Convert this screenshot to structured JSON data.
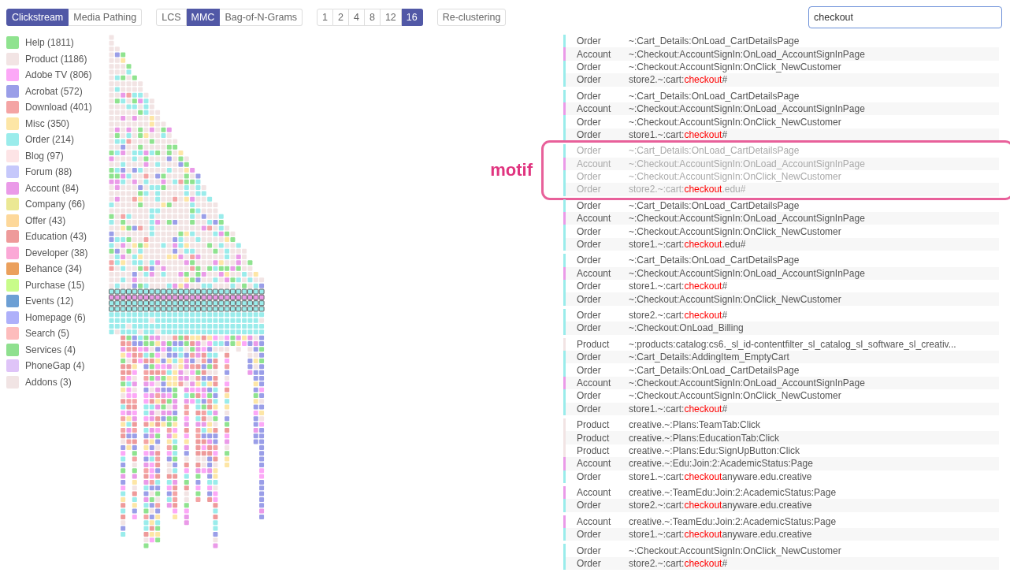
{
  "toolbar": [
    {
      "buttons": [
        {
          "label": "Clickstream",
          "selected": true
        },
        {
          "label": "Media Pathing",
          "selected": false
        }
      ]
    },
    {
      "buttons": [
        {
          "label": "LCS",
          "selected": false
        },
        {
          "label": "MMC",
          "selected": true
        },
        {
          "label": "Bag-of-N-Grams",
          "selected": false
        }
      ]
    },
    {
      "buttons": [
        {
          "label": "1",
          "selected": false
        },
        {
          "label": "2",
          "selected": false
        },
        {
          "label": "4",
          "selected": false
        },
        {
          "label": "8",
          "selected": false
        },
        {
          "label": "12",
          "selected": false
        },
        {
          "label": "16",
          "selected": true
        }
      ]
    },
    {
      "buttons": [
        {
          "label": "Re-clustering",
          "selected": false
        }
      ]
    }
  ],
  "search": {
    "value": "checkout"
  },
  "legend": [
    {
      "label": "Help (1811)",
      "color": "#8fe38f"
    },
    {
      "label": "Product (1186)",
      "color": "#f2e4e4"
    },
    {
      "label": "Adobe TV (806)",
      "color": "#fca8f7"
    },
    {
      "label": "Acrobat (572)",
      "color": "#9a9ee8"
    },
    {
      "label": "Download (401)",
      "color": "#f4a4a4"
    },
    {
      "label": "Misc (350)",
      "color": "#fde6a6"
    },
    {
      "label": "Order (214)",
      "color": "#9aeceb"
    },
    {
      "label": "Blog (97)",
      "color": "#fde4e6"
    },
    {
      "label": "Forum (88)",
      "color": "#c6c8fb"
    },
    {
      "label": "Account (84)",
      "color": "#ea9ae8"
    },
    {
      "label": "Company (66)",
      "color": "#ebe894"
    },
    {
      "label": "Offer (43)",
      "color": "#fdd89a"
    },
    {
      "label": "Education (43)",
      "color": "#ee9a9a"
    },
    {
      "label": "Developer (38)",
      "color": "#fba8d6"
    },
    {
      "label": "Behance (34)",
      "color": "#eba05c"
    },
    {
      "label": "Purchase (15)",
      "color": "#c8fc8a"
    },
    {
      "label": "Events (12)",
      "color": "#6c9fd4"
    },
    {
      "label": "Homepage (6)",
      "color": "#aeb0fa"
    },
    {
      "label": "Search (5)",
      "color": "#fdbcbc"
    },
    {
      "label": "Services (4)",
      "color": "#8fe08f"
    },
    {
      "label": "PhoneGap (4)",
      "color": "#dfc4f8"
    },
    {
      "label": "Addons (3)",
      "color": "#f1e4e4"
    }
  ],
  "groups": [
    {
      "highlighted": false,
      "events": [
        {
          "category": "Order",
          "color": "#9aeceb",
          "text": "~:Cart_Details:OnLoad_CartDetailsPage"
        },
        {
          "category": "Account",
          "color": "#ea9ae8",
          "text": "~:Checkout:AccountSignIn:OnLoad_AccountSignInPage"
        },
        {
          "category": "Order",
          "color": "#9aeceb",
          "text": "~:Checkout:AccountSignIn:OnClick_NewCustomer"
        },
        {
          "category": "Order",
          "color": "#9aeceb",
          "text": "store2.~:cart:",
          "match": "checkout",
          "rest": "#"
        }
      ]
    },
    {
      "highlighted": false,
      "events": [
        {
          "category": "Order",
          "color": "#9aeceb",
          "text": "~:Cart_Details:OnLoad_CartDetailsPage"
        },
        {
          "category": "Account",
          "color": "#ea9ae8",
          "text": "~:Checkout:AccountSignIn:OnLoad_AccountSignInPage"
        },
        {
          "category": "Order",
          "color": "#9aeceb",
          "text": "~:Checkout:AccountSignIn:OnClick_NewCustomer"
        },
        {
          "category": "Order",
          "color": "#9aeceb",
          "text": "store1.~:cart:",
          "match": "checkout",
          "rest": "#"
        }
      ]
    },
    {
      "highlighted": true,
      "label": "motif",
      "events": [
        {
          "category": "Order",
          "color": "#9aeceb",
          "text": "~:Cart_Details:OnLoad_CartDetailsPage"
        },
        {
          "category": "Account",
          "color": "#ea9ae8",
          "text": "~:Checkout:AccountSignIn:OnLoad_AccountSignInPage"
        },
        {
          "category": "Order",
          "color": "#9aeceb",
          "text": "~:Checkout:AccountSignIn:OnClick_NewCustomer"
        },
        {
          "category": "Order",
          "color": "#9aeceb",
          "text": "store2.~:cart:",
          "match": "checkout",
          "rest": ".edu#"
        }
      ]
    },
    {
      "highlighted": false,
      "events": [
        {
          "category": "Order",
          "color": "#9aeceb",
          "text": "~:Cart_Details:OnLoad_CartDetailsPage"
        },
        {
          "category": "Account",
          "color": "#ea9ae8",
          "text": "~:Checkout:AccountSignIn:OnLoad_AccountSignInPage"
        },
        {
          "category": "Order",
          "color": "#9aeceb",
          "text": "~:Checkout:AccountSignIn:OnClick_NewCustomer"
        },
        {
          "category": "Order",
          "color": "#9aeceb",
          "text": "store1.~:cart:",
          "match": "checkout",
          "rest": ".edu#"
        }
      ]
    },
    {
      "highlighted": false,
      "events": [
        {
          "category": "Order",
          "color": "#9aeceb",
          "text": "~:Cart_Details:OnLoad_CartDetailsPage"
        },
        {
          "category": "Account",
          "color": "#ea9ae8",
          "text": "~:Checkout:AccountSignIn:OnLoad_AccountSignInPage"
        },
        {
          "category": "Order",
          "color": "#9aeceb",
          "text": "store1.~:cart:",
          "match": "checkout",
          "rest": "#"
        },
        {
          "category": "Order",
          "color": "#9aeceb",
          "text": "~:Checkout:AccountSignIn:OnClick_NewCustomer"
        }
      ]
    },
    {
      "highlighted": false,
      "events": [
        {
          "category": "Order",
          "color": "#9aeceb",
          "text": "store2.~:cart:",
          "match": "checkout",
          "rest": "#"
        },
        {
          "category": "Order",
          "color": "#9aeceb",
          "text": "~:Checkout:OnLoad_Billing"
        }
      ]
    },
    {
      "highlighted": false,
      "events": [
        {
          "category": "Product",
          "color": "#f2e4e4",
          "text": "~:products:catalog:cs6._sl_id-contentfilter_sl_catalog_sl_software_sl_creativ..."
        },
        {
          "category": "Order",
          "color": "#9aeceb",
          "text": "~:Cart_Details:AddingItem_EmptyCart"
        },
        {
          "category": "Order",
          "color": "#9aeceb",
          "text": "~:Cart_Details:OnLoad_CartDetailsPage"
        },
        {
          "category": "Account",
          "color": "#ea9ae8",
          "text": "~:Checkout:AccountSignIn:OnLoad_AccountSignInPage"
        },
        {
          "category": "Order",
          "color": "#9aeceb",
          "text": "~:Checkout:AccountSignIn:OnClick_NewCustomer"
        },
        {
          "category": "Order",
          "color": "#9aeceb",
          "text": "store1.~:cart:",
          "match": "checkout",
          "rest": "#"
        }
      ]
    },
    {
      "highlighted": false,
      "events": [
        {
          "category": "Product",
          "color": "#f2e4e4",
          "text": "creative.~:Plans:TeamTab:Click"
        },
        {
          "category": "Product",
          "color": "#f2e4e4",
          "text": "creative.~:Plans:EducationTab:Click"
        },
        {
          "category": "Product",
          "color": "#f2e4e4",
          "text": "creative.~:Plans:Edu:SignUpButton:Click"
        },
        {
          "category": "Account",
          "color": "#ea9ae8",
          "text": "creative.~:Edu:Join:2:AcademicStatus:Page"
        },
        {
          "category": "Order",
          "color": "#9aeceb",
          "text": "store1.~:cart:",
          "match": "checkout",
          "rest": "anyware.edu.creative"
        }
      ]
    },
    {
      "highlighted": false,
      "events": [
        {
          "category": "Account",
          "color": "#ea9ae8",
          "text": "creative.~:TeamEdu:Join:2:AcademicStatus:Page"
        },
        {
          "category": "Order",
          "color": "#9aeceb",
          "text": "store2.~:cart:",
          "match": "checkout",
          "rest": "anyware.edu.creative"
        }
      ]
    },
    {
      "highlighted": false,
      "events": [
        {
          "category": "Account",
          "color": "#ea9ae8",
          "text": "creative.~:TeamEdu:Join:2:AcademicStatus:Page"
        },
        {
          "category": "Order",
          "color": "#9aeceb",
          "text": "store1.~:cart:",
          "match": "checkout",
          "rest": "anyware.edu.creative"
        }
      ]
    },
    {
      "highlighted": false,
      "events": [
        {
          "category": "Order",
          "color": "#9aeceb",
          "text": "~:Checkout:AccountSignIn:OnClick_NewCustomer"
        },
        {
          "category": "Order",
          "color": "#9aeceb",
          "text": "store2.~:cart:",
          "match": "checkout",
          "rest": "#"
        }
      ]
    }
  ]
}
